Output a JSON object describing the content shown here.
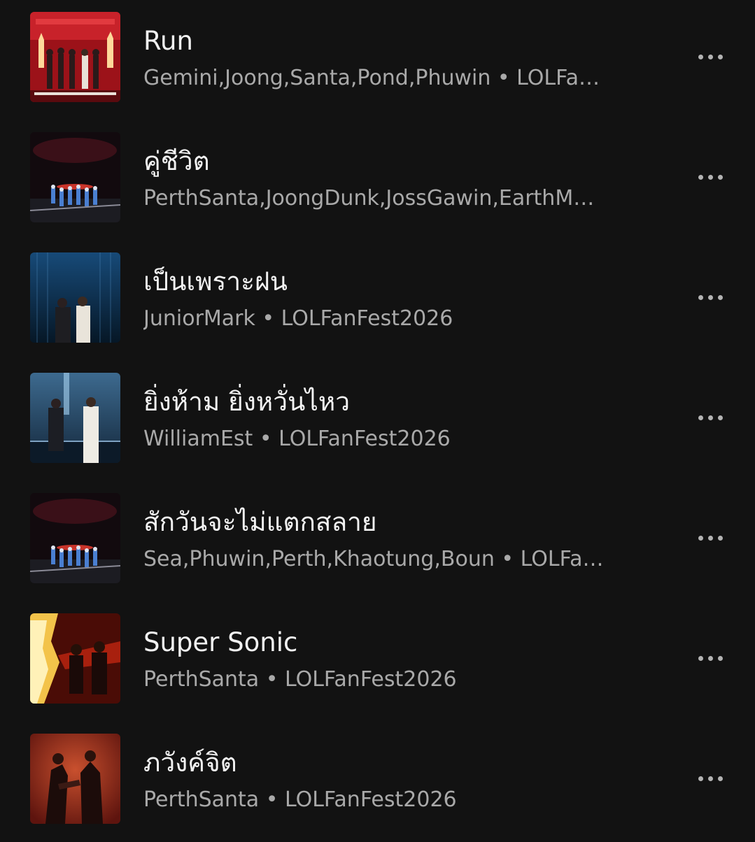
{
  "tracks": [
    {
      "title": "Run",
      "subtitle": "Gemini,Joong,Santa,Pond,Phuwin • LOLFa…",
      "thumb_color": "#b0151c"
    },
    {
      "title": "คู่ชีวิต",
      "subtitle": "PerthSanta,JoongDunk,JossGawin,EarthM…",
      "thumb_color": "#1a0f14"
    },
    {
      "title": "เป็นเพราะฝน",
      "subtitle": "JuniorMark • LOLFanFest2026",
      "thumb_color": "#0e2a45"
    },
    {
      "title": "ยิ่งห้าม ยิ่งหวั่นไหว",
      "subtitle": "WilliamEst • LOLFanFest2026",
      "thumb_color": "#2a4e70"
    },
    {
      "title": "สักวันจะไม่แตกสลาย",
      "subtitle": "Sea,Phuwin,Perth,Khaotung,Boun • LOLFa…",
      "thumb_color": "#1a0f14"
    },
    {
      "title": "Super Sonic",
      "subtitle": "PerthSanta • LOLFanFest2026",
      "thumb_color": "#6e1208"
    },
    {
      "title": "ภวังค์จิต",
      "subtitle": "PerthSanta • LOLFanFest2026",
      "thumb_color": "#7a2418"
    }
  ],
  "icons": {
    "more": "more-options-icon"
  },
  "colors": {
    "background": "#121212",
    "title": "#f2f2f2",
    "subtitle": "#a9a9a9"
  }
}
